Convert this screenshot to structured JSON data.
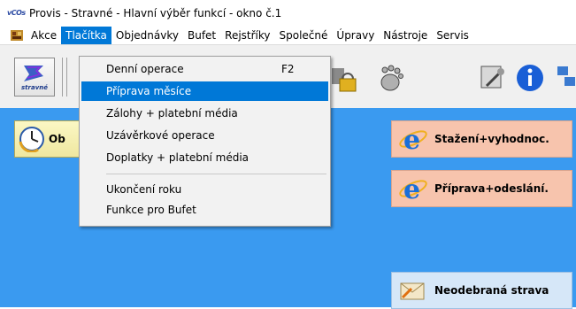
{
  "window": {
    "app_icon_text": "vCOs",
    "title": "Provis - Stravné - Hlavní výběr funkcí - okno č.1"
  },
  "menu": {
    "items": [
      "Akce",
      "Tlačítka",
      "Objednávky",
      "Bufet",
      "Rejstříky",
      "Společné",
      "Úpravy",
      "Nástroje",
      "Servis"
    ],
    "active": "Tlačítka"
  },
  "dropdown": {
    "items": [
      {
        "label": "Denní operace",
        "shortcut": "F2"
      },
      {
        "label": "Příprava měsíce",
        "shortcut": "",
        "highlighted": true
      },
      {
        "label": "Zálohy + platební média",
        "shortcut": ""
      },
      {
        "label": "Uzávěrkové operace",
        "shortcut": ""
      },
      {
        "label": "Doplatky + platební média",
        "shortcut": ""
      },
      {
        "label": "Ukončení roku",
        "shortcut": ""
      },
      {
        "label": "Funkce pro Bufet",
        "shortcut": ""
      }
    ]
  },
  "toolbar": {
    "stravne_label": "stravné",
    "icons": [
      "stravne-icon",
      "lock-icon",
      "footprint-icon",
      "tools-icon",
      "info-icon",
      "network-icon"
    ]
  },
  "main": {
    "obed_button_label": "Ob",
    "buttons": [
      {
        "label": "Stažení+vyhodnoc.",
        "icon": "ie-icon"
      },
      {
        "label": "Příprava+odeslání.",
        "icon": "ie-icon"
      },
      {
        "label": "Neodebraná strava",
        "icon": "envelope-icon"
      }
    ]
  },
  "colors": {
    "background": "#3a9af0",
    "menu_highlight": "#0078d7",
    "orange_button": "#f7c4ad",
    "blue_button": "#d6e7f8"
  }
}
